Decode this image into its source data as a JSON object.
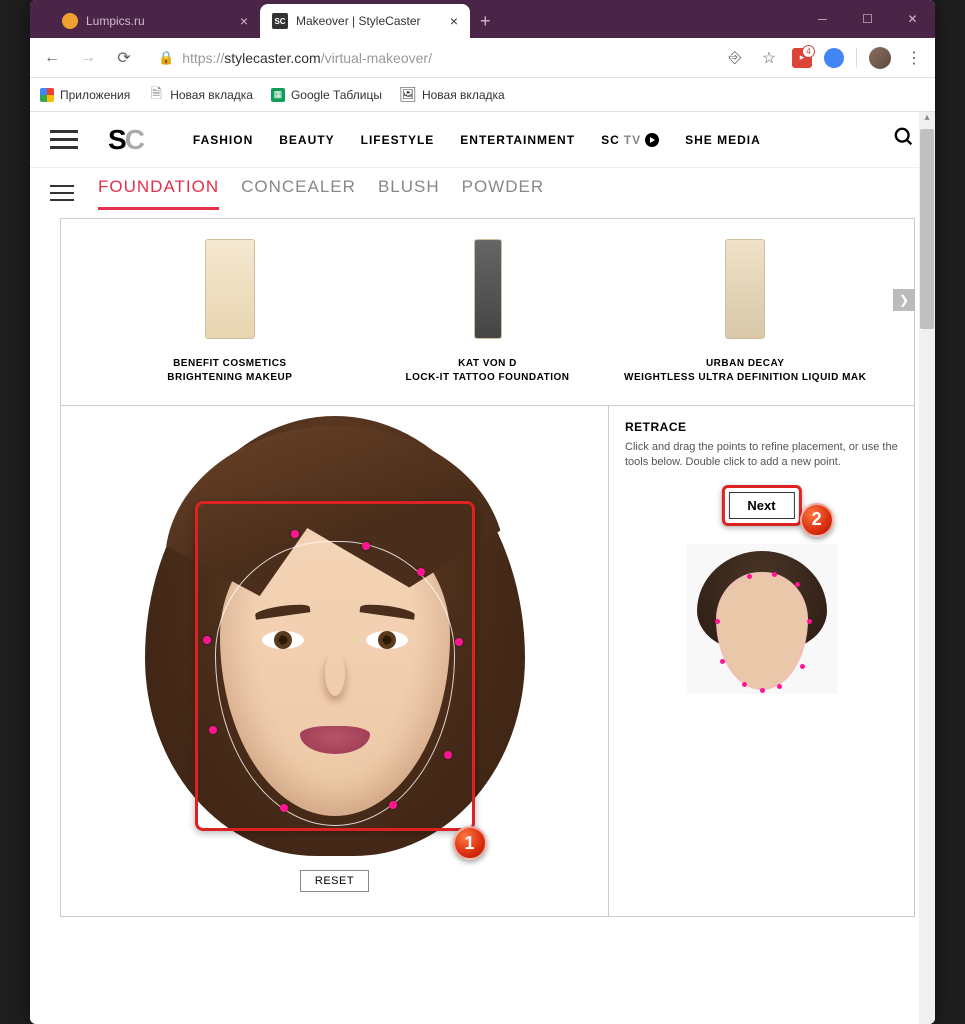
{
  "window": {
    "tabs": [
      {
        "title": "Lumpics.ru",
        "active": false
      },
      {
        "title": "Makeover | StyleCaster",
        "active": true,
        "favicon": "SC"
      }
    ],
    "new_tab": "+"
  },
  "toolbar": {
    "url_protocol": "https://",
    "url_host": "stylecaster.com",
    "url_path": "/virtual-makeover/",
    "ext_badge": "4"
  },
  "bookmarks": {
    "items": [
      {
        "label": "Приложения",
        "icon": "apps"
      },
      {
        "label": "Новая вкладка",
        "icon": "doc"
      },
      {
        "label": "Google Таблицы",
        "icon": "sheets"
      },
      {
        "label": "Новая вкладка",
        "icon": "img"
      }
    ]
  },
  "site": {
    "logo_s": "S",
    "logo_c": "C",
    "nav": [
      "FASHION",
      "BEAUTY",
      "LIFESTYLE",
      "ENTERTAINMENT"
    ],
    "nav_tv_prefix": "SC",
    "nav_tv_suffix": "TV",
    "nav_last": "SHE MEDIA"
  },
  "app": {
    "tabs": [
      {
        "label": "FOUNDATION",
        "active": true
      },
      {
        "label": "CONCEALER",
        "active": false
      },
      {
        "label": "BLUSH",
        "active": false
      },
      {
        "label": "POWDER",
        "active": false
      }
    ]
  },
  "products": [
    {
      "brand": "BENEFIT COSMETICS",
      "name": "BRIGHTENING MAKEUP"
    },
    {
      "brand": "KAT VON D",
      "name": "LOCK-IT TATTOO FOUNDATION"
    },
    {
      "brand": "URBAN DECAY",
      "name": "WEIGHTLESS ULTRA DEFINITION LIQUID MAK"
    }
  ],
  "canvas": {
    "reset_label": "RESET",
    "badge1": "1"
  },
  "panel": {
    "title": "RETRACE",
    "desc": "Click and drag the points to refine placement, or use the tools below. Double click to add a new point.",
    "next_label": "Next",
    "badge2": "2"
  }
}
